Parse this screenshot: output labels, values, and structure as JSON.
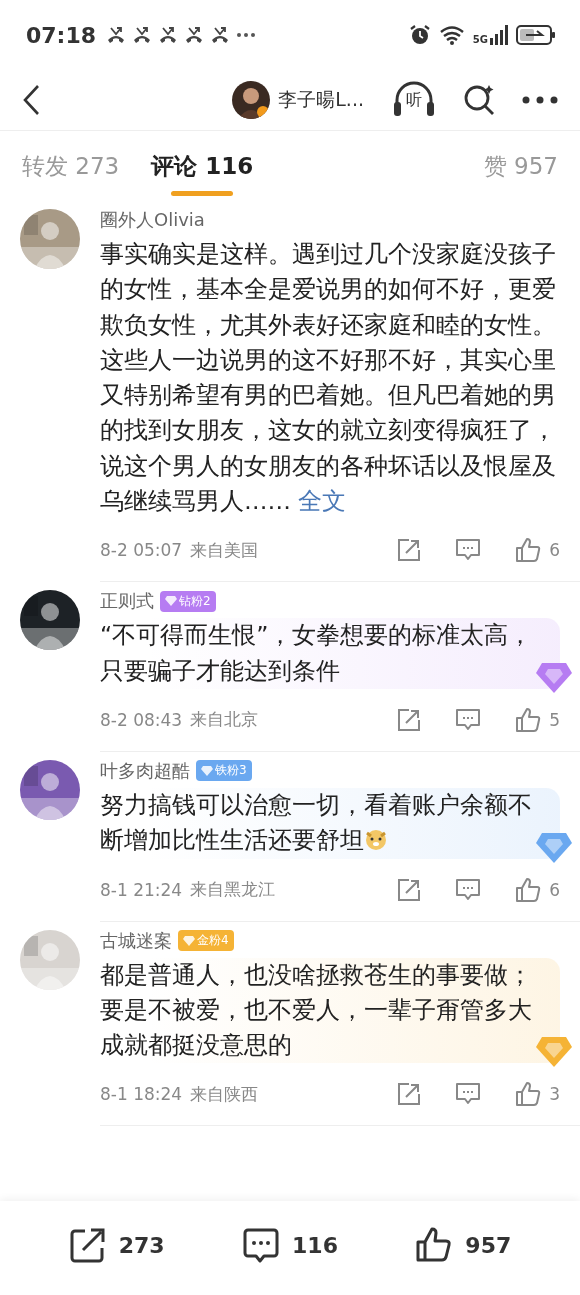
{
  "status_bar": {
    "time": "07:18",
    "network": "5G"
  },
  "header": {
    "author": "李子暘L...",
    "listen": "听"
  },
  "tabs": [
    {
      "label": "转发 273",
      "selected": false
    },
    {
      "label": "评论 116",
      "selected": true
    },
    {
      "label": "赞 957",
      "selected": false
    }
  ],
  "comments": [
    {
      "user": "圈外人Olivia",
      "body": "事实确实是这样。遇到过几个没家庭没孩子的女性，基本全是爱说男的如何不好，更爱欺负女性，尤其外表好还家庭和睦的女性。这些人一边说男的这不好那不好，其实心里又特别希望有男的巴着她。但凡巴着她的男的找到女朋友，这女的就立刻变得疯狂了，说这个男人的女朋友的各种坏话以及恨屋及乌继续骂男人……",
      "more_link": "全文",
      "time": "8-2 05:07",
      "location": "来自美国",
      "likes": "6"
    },
    {
      "user": "正则式",
      "badge": {
        "label": "钻粉2",
        "color": "#b67cf2"
      },
      "body": "“不可得而生恨”，女拳想要的标准太高，只要骗子才能达到条件",
      "time": "8-2 08:43",
      "location": "来自北京",
      "likes": "5"
    },
    {
      "user": "叶多肉超酷",
      "badge": {
        "label": "铁粉3",
        "color": "#6aa8f0"
      },
      "body": "努力搞钱可以治愈一切，看着账户余额不断增加比性生活还要舒坦",
      "emoji": true,
      "time": "8-1 21:24",
      "location": "来自黑龙江",
      "likes": "6"
    },
    {
      "user": "古城迷案",
      "badge": {
        "label": "金粉4",
        "color": "#f5b335"
      },
      "body": "都是普通人，也没啥拯救苍生的事要做；要是不被爱，也不爱人，一辈子甭管多大成就都挺没意思的",
      "time": "8-1 18:24",
      "location": "来自陕西",
      "likes": "3"
    }
  ],
  "footer": [
    {
      "kind": "repost",
      "count": "273"
    },
    {
      "kind": "comment",
      "count": "116"
    },
    {
      "kind": "like",
      "count": "957"
    }
  ]
}
